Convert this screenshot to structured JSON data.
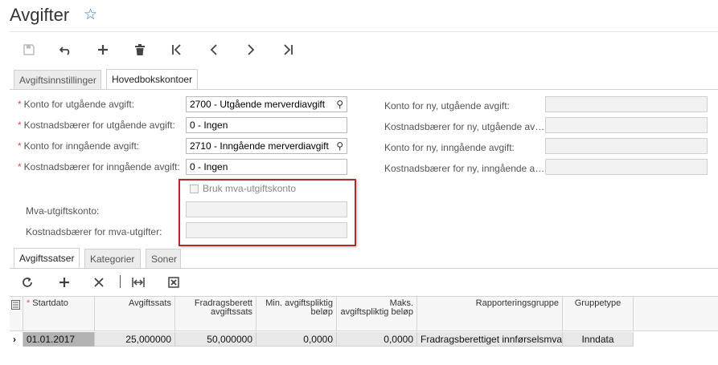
{
  "page": {
    "title": "Avgifter",
    "favorite_icon": "star-outline-icon"
  },
  "toolbar": {
    "icons": [
      "save-icon",
      "undo-icon",
      "add-icon",
      "delete-icon",
      "first-record-icon",
      "previous-record-icon",
      "next-record-icon",
      "last-record-icon"
    ]
  },
  "tabs": [
    {
      "label": "Avgiftsinnstillinger",
      "active": false
    },
    {
      "label": "Hovedbokskontoer",
      "active": true
    }
  ],
  "form": {
    "left": [
      {
        "label": "Konto for utgående avgift:",
        "value": "2700 - Utgående merverdiavgift",
        "required": true,
        "lookup": true
      },
      {
        "label": "Kostnadsbærer for utgående avgift:",
        "value": "0 - Ingen",
        "required": true,
        "lookup": false
      },
      {
        "label": "Konto for inngående avgift:",
        "value": "2710 - Inngående merverdiavgift",
        "required": true,
        "lookup": true
      },
      {
        "label": "Kostnadsbærer for inngående avgift:",
        "value": "0 - Ingen",
        "required": true,
        "lookup": false
      }
    ],
    "right": [
      {
        "label": "Konto for ny, utgående avgift:",
        "value": ""
      },
      {
        "label": "Kostnadsbærer for ny, utgående av…",
        "value": ""
      },
      {
        "label": "Konto for ny, inngående avgift:",
        "value": ""
      },
      {
        "label": "Kostnadsbærer for ny, inngående a…",
        "value": ""
      }
    ],
    "mva": {
      "checkbox_label": "Bruk mva-utgiftskonto",
      "checked": false,
      "account_label": "Mva-utgiftskonto:",
      "account_value": "",
      "costcenter_label": "Kostnadsbærer for mva-utgifter:",
      "costcenter_value": ""
    },
    "highlight_color": "#b02a2a"
  },
  "bottom_tabs": [
    {
      "label": "Avgiftssatser",
      "active": true
    },
    {
      "label": "Kategorier",
      "active": false
    },
    {
      "label": "Soner",
      "active": false
    }
  ],
  "grid_toolbar": {
    "icons": [
      "refresh-icon",
      "add-row-icon",
      "delete-row-icon",
      "fit-columns-icon",
      "export-excel-icon"
    ]
  },
  "grid": {
    "columns": [
      {
        "label": "Startdato",
        "required": true
      },
      {
        "label": "Avgiftssats"
      },
      {
        "label": "Fradragsberett avgiftssats"
      },
      {
        "label": "Min. avgiftspliktig beløp"
      },
      {
        "label": "Maks. avgiftspliktig beløp"
      },
      {
        "label": "Rapporteringsgruppe"
      },
      {
        "label": "Gruppetype"
      }
    ],
    "rows": [
      [
        "01.01.2017",
        "25,000000",
        "50,000000",
        "0,0000",
        "0,0000",
        "Fradragsberettiget innførselsmva",
        "Inndata"
      ]
    ]
  }
}
